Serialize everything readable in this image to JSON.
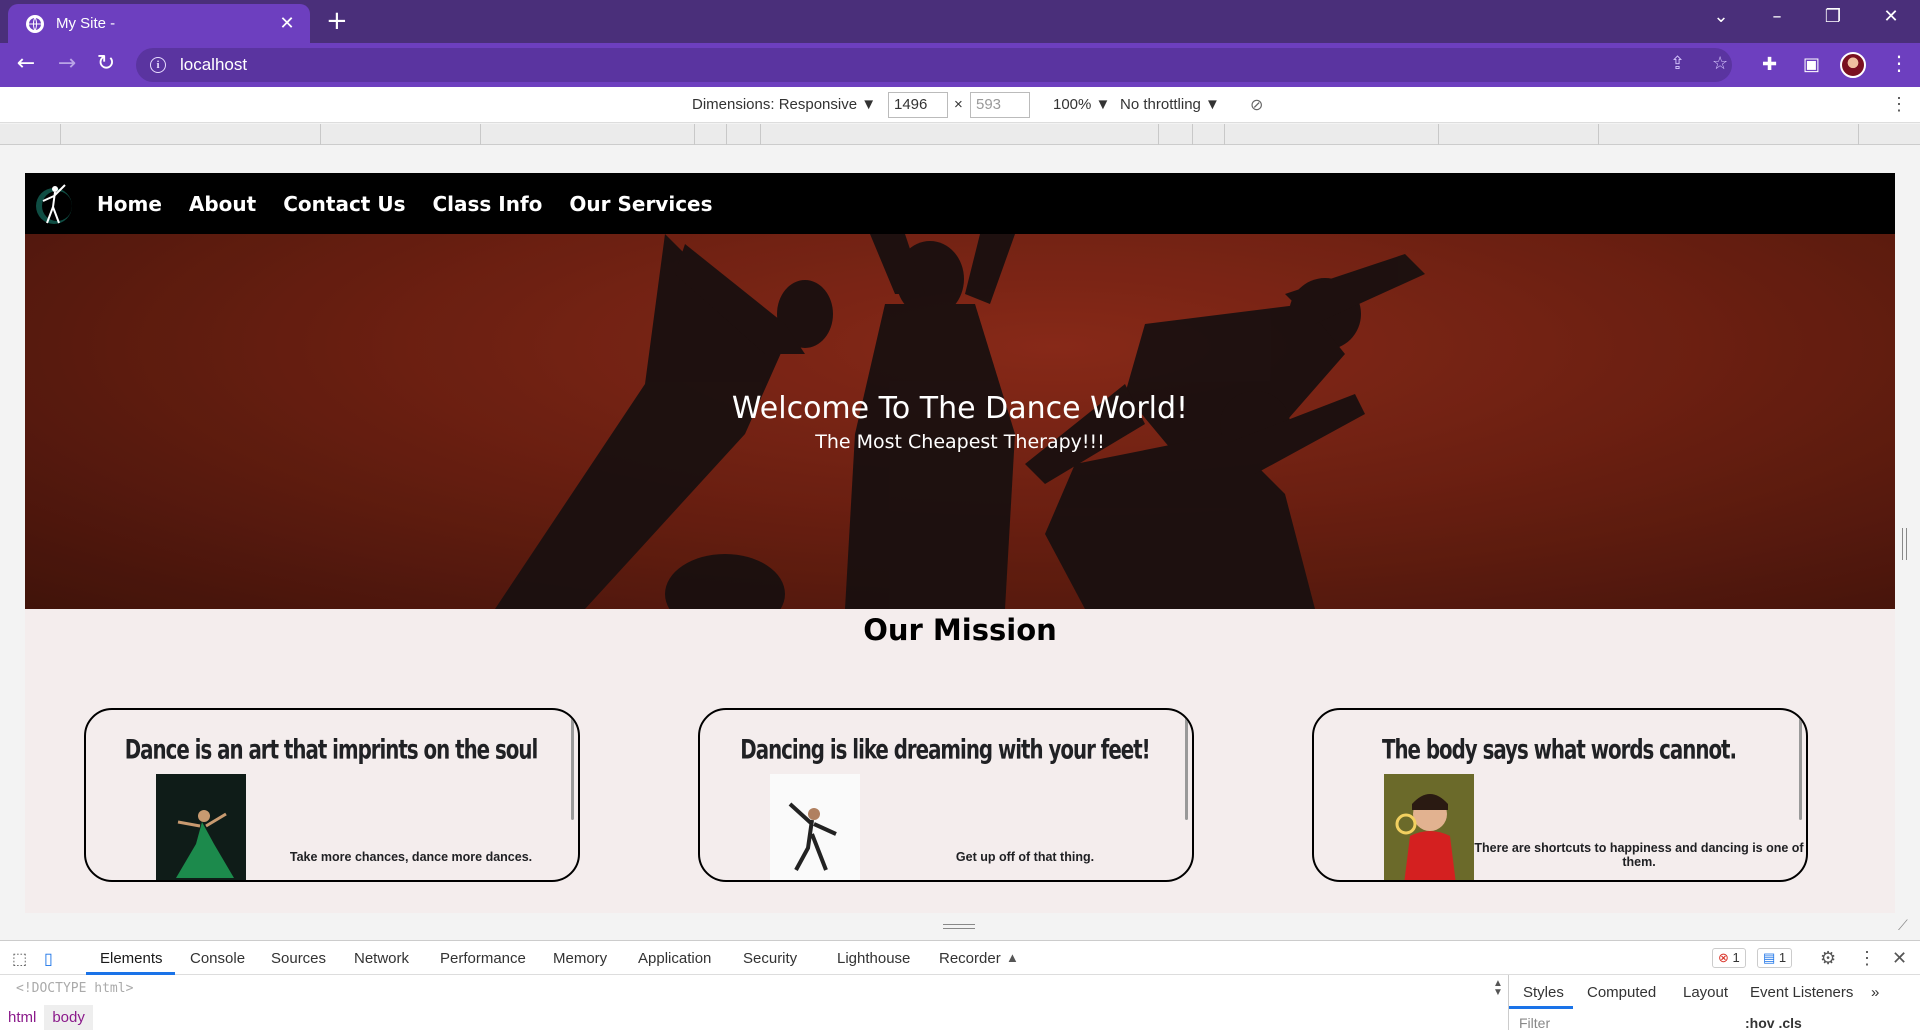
{
  "browser": {
    "tab_title": "My Site -",
    "url": "localhost",
    "icons": [
      "globe-icon",
      "close-icon",
      "plus-icon",
      "back-icon",
      "forward-icon",
      "reload-icon",
      "info-icon",
      "share-icon",
      "star-icon",
      "puzzle-icon",
      "sidepanel-icon",
      "avatar",
      "kebab-icon"
    ]
  },
  "device_toolbar": {
    "dimensions_label": "Dimensions: Responsive ▼",
    "width": "1496",
    "height": "593",
    "x_sep": "×",
    "zoom": "100% ▼",
    "throttling": "No throttling ▼"
  },
  "site": {
    "nav": [
      "Home",
      "About",
      "Contact Us",
      "Class Info",
      "Our Services"
    ],
    "hero_title": "Welcome To The Dance World!",
    "hero_subtitle": "The Most Cheapest Therapy!!!",
    "mission_title": "Our Mission",
    "cards": [
      {
        "heading": "Dance is an art that imprints on the soul",
        "text": "Take more chances, dance more dances."
      },
      {
        "heading": "Dancing is like dreaming with your feet!",
        "text": "Get up off of that thing."
      },
      {
        "heading": "The body says what words cannot.",
        "text": "There are shortcuts to happiness and dancing is one of them."
      }
    ]
  },
  "devtools": {
    "tabs": [
      "Elements",
      "Console",
      "Sources",
      "Network",
      "Performance",
      "Memory",
      "Application",
      "Security",
      "Lighthouse",
      "Recorder"
    ],
    "errors": "1",
    "messages": "1",
    "dom_line": "<!DOCTYPE html>",
    "breadcrumbs": [
      "html",
      "body"
    ],
    "styles_tabs": [
      "Styles",
      "Computed",
      "Layout",
      "Event Listeners"
    ],
    "filter_placeholder": "Filter",
    "hov_cls": ":hov .cls"
  },
  "colors": {
    "tabbar": "#4a2f7a",
    "toolbar": "#6d3fbf",
    "site_nav": "#000000",
    "page_bg": "#f4eded",
    "devtools_accent": "#1a73e8"
  }
}
